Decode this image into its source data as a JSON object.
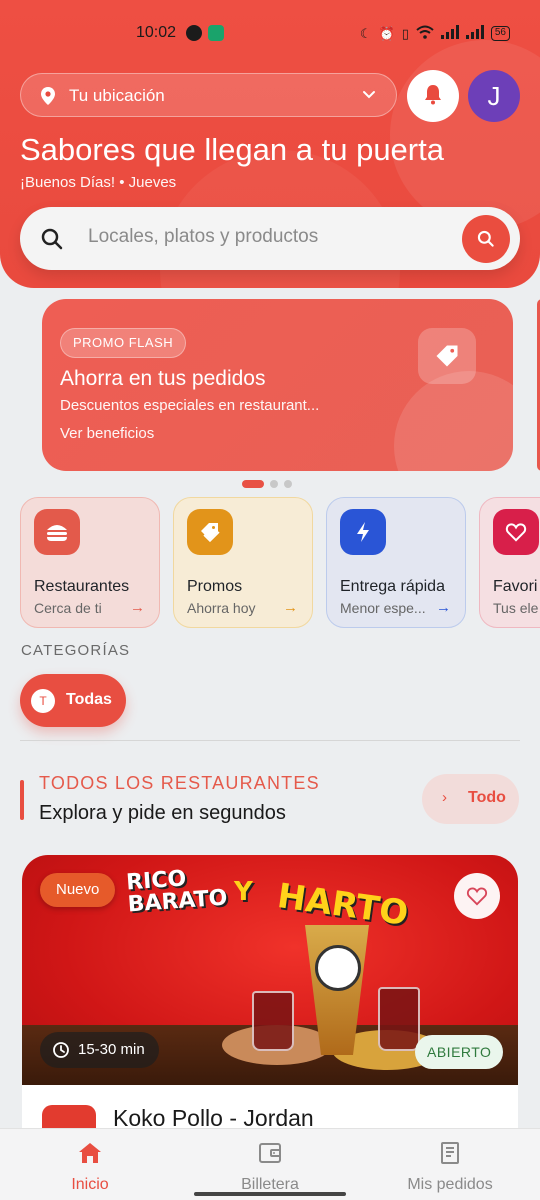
{
  "status_bar": {
    "time": "10:02",
    "battery": "56"
  },
  "header": {
    "location_label": "Tu ubicación",
    "avatar_initial": "J",
    "title": "Sabores que llegan a tu puerta",
    "greeting": "¡Buenos Días! • Jueves",
    "search_placeholder": "Locales, platos y productos"
  },
  "promo": {
    "badge": "PROMO FLASH",
    "title": "Ahorra en tus pedidos",
    "subtitle": "Descuentos especiales en restaurant...",
    "link": "Ver beneficios",
    "carousel_index": 1,
    "carousel_count": 3
  },
  "quick_access": [
    {
      "title": "Restaurantes",
      "subtitle": "Cerca de ti",
      "icon": "burger-icon",
      "accent": "#e35a4b"
    },
    {
      "title": "Promos",
      "subtitle": "Ahorra hoy",
      "icon": "tag-icon",
      "accent": "#e2941a"
    },
    {
      "title": "Entrega rápida",
      "subtitle": "Menor espe...",
      "icon": "bolt-icon",
      "accent": "#2a55d6"
    },
    {
      "title": "Favori",
      "subtitle": "Tus ele",
      "icon": "heart-icon",
      "accent": "#d81f4a"
    }
  ],
  "categories": {
    "label": "CATEGORÍAS",
    "chips": [
      {
        "letter": "T",
        "label": "Todas",
        "selected": true
      }
    ]
  },
  "restaurants_section": {
    "kicker": "TODOS LOS RESTAURANTES",
    "title": "Explora y pide en segundos",
    "see_all": "Todo"
  },
  "restaurant_card": {
    "badge": "Nuevo",
    "banner_line1": "RICO",
    "banner_line2": "BARATO",
    "banner_y": "Y",
    "banner_harto": "HARTO",
    "delivery_time": "15-30 min",
    "status": "ABIERTO",
    "name": "Koko Pollo - Jordan"
  },
  "bottom_nav": [
    {
      "label": "Inicio",
      "icon": "home-icon",
      "active": true
    },
    {
      "label": "Billetera",
      "icon": "wallet-icon",
      "active": false
    },
    {
      "label": "Mis pedidos",
      "icon": "receipt-icon",
      "active": false
    }
  ],
  "colors": {
    "brand": "#e84e41",
    "open_status": "#2f7a3d"
  }
}
